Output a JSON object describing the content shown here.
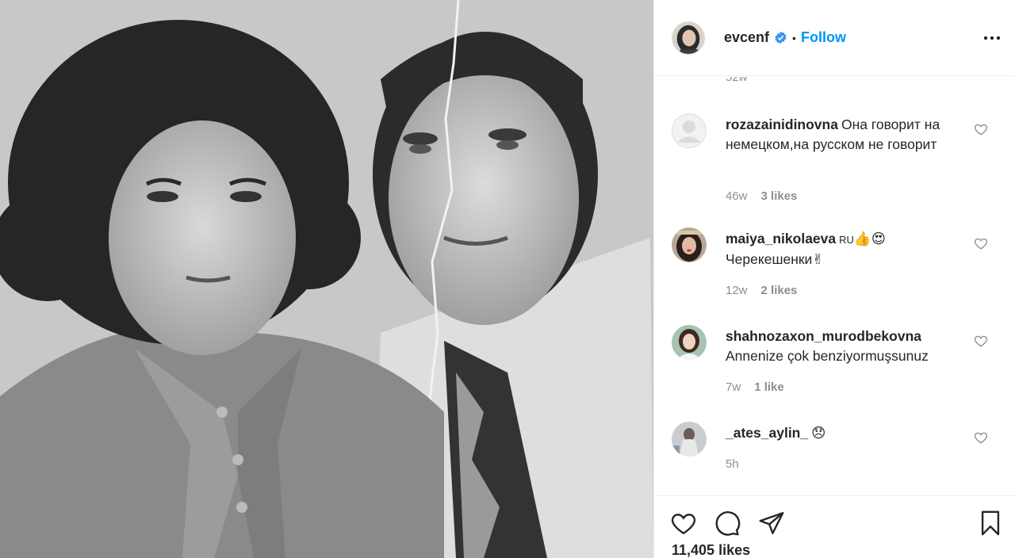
{
  "post": {
    "username": "evcenf",
    "follow_label": "Follow",
    "separator": "•",
    "likes_count": "11,405 likes"
  },
  "comments_prev_time": "52w",
  "comments": [
    {
      "username": "rozazainidinovna",
      "text": "Она говорит на немецком,на русском не говорит",
      "time": "46w",
      "likes": "3 likes",
      "avatar": "default-avatar-icon"
    },
    {
      "username": "maiya_nikolaeva",
      "text_prefix": "RU",
      "text_emoji": "👍😍",
      "text_line2": "Черекешенки✌",
      "time": "12w",
      "likes": "2 likes",
      "avatar": "user-photo"
    },
    {
      "username": "shahnozaxon_murodbekovna",
      "text": "Annenize çok benziyormuşsunuz",
      "time": "7w",
      "likes": "1 like",
      "avatar": "user-photo"
    },
    {
      "username": "_ates_aylin_",
      "text": "😞",
      "time": "5h",
      "likes": "",
      "avatar": "user-photo"
    }
  ],
  "icons": {
    "verified": "verified-badge-icon",
    "more": "more-options-icon",
    "like": "heart-icon",
    "comment": "comment-icon",
    "share": "share-icon",
    "save": "bookmark-icon"
  },
  "colors": {
    "accent": "#0095f6",
    "muted": "#8e8e8e",
    "text": "#262626"
  }
}
